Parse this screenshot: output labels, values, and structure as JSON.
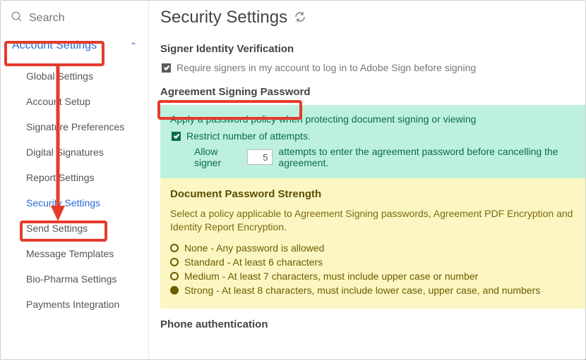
{
  "search": {
    "placeholder": "Search"
  },
  "sidebar": {
    "parent": "Account Settings",
    "items": [
      {
        "label": "Global Settings"
      },
      {
        "label": "Account Setup"
      },
      {
        "label": "Signature Preferences"
      },
      {
        "label": "Digital Signatures"
      },
      {
        "label": "Report Settings"
      },
      {
        "label": "Security Settings"
      },
      {
        "label": "Send Settings"
      },
      {
        "label": "Message Templates"
      },
      {
        "label": "Bio-Pharma Settings"
      },
      {
        "label": "Payments Integration"
      }
    ],
    "activeIndex": 5
  },
  "page": {
    "title": "Security Settings",
    "signer": {
      "heading": "Signer Identity Verification",
      "require_label": "Require signers in my account to log in to Adobe Sign before signing",
      "require_checked": true
    },
    "agreement": {
      "heading": "Agreement Signing Password",
      "policy_title": "Apply a password policy when protecting document signing or viewing",
      "restrict_label": "Restrict number of attempts.",
      "restrict_checked": true,
      "allow_prefix": "Allow signer",
      "attempts": "5",
      "allow_suffix": "attempts to enter the agreement password before cancelling the agreement."
    },
    "strength": {
      "heading": "Document Password Strength",
      "description": "Select a policy applicable to Agreement Signing passwords, Agreement PDF Encryption and Identity Report Encryption.",
      "options": [
        {
          "label": "None - Any password is allowed",
          "selected": false
        },
        {
          "label": "Standard - At least 6 characters",
          "selected": false
        },
        {
          "label": "Medium - At least 7 characters, must include upper case or number",
          "selected": false
        },
        {
          "label": "Strong - At least 8 characters, must include lower case, upper case, and numbers",
          "selected": true
        }
      ]
    },
    "phone_heading": "Phone authentication"
  },
  "colors": {
    "highlight": "#e53b2c",
    "link": "#2b6bd4",
    "teal": "#bdf1de",
    "yellow": "#fcf7c2"
  }
}
